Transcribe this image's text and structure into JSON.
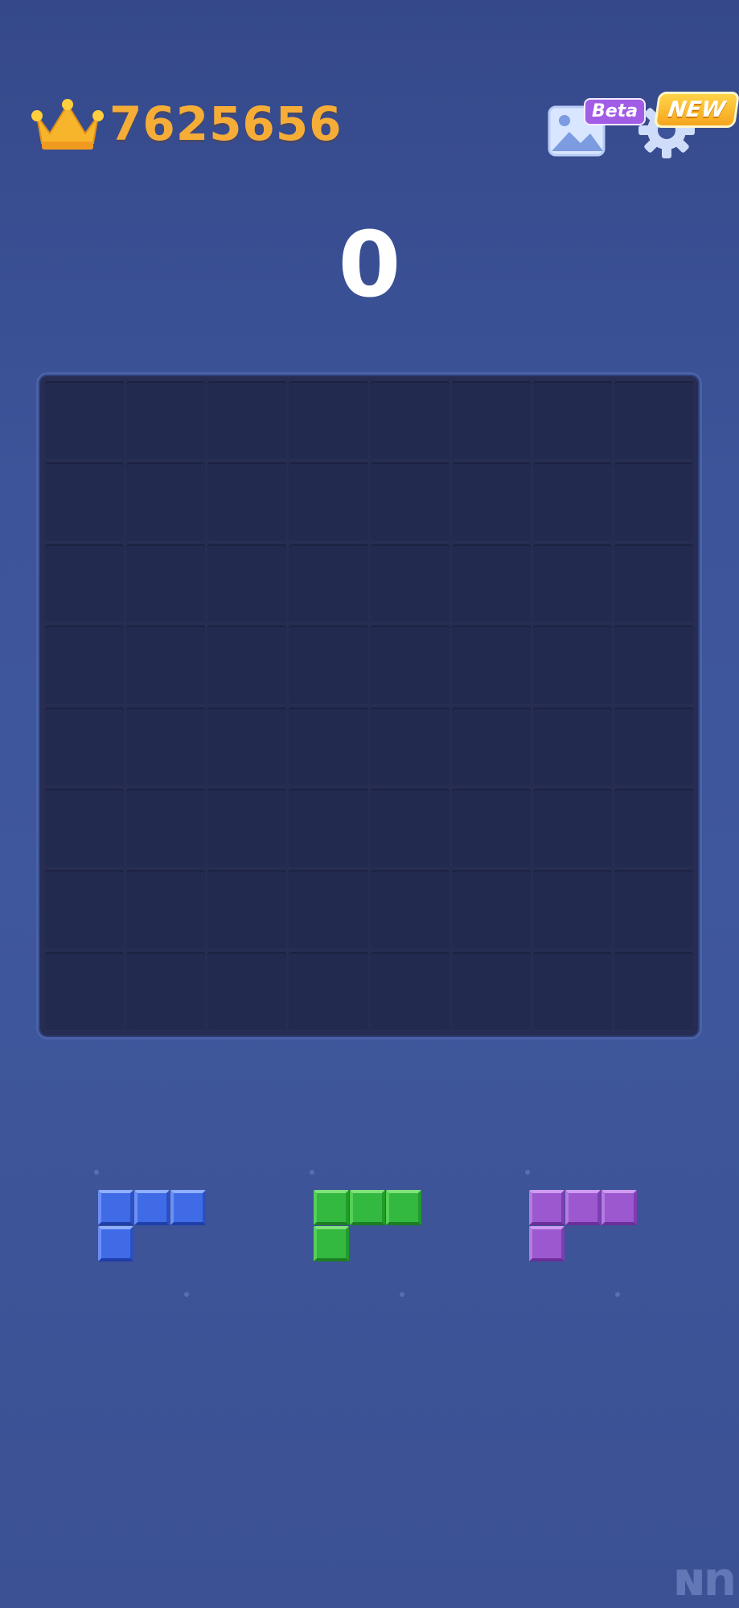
{
  "header": {
    "ghost_title": "",
    "best_score": "7625656",
    "gallery_badge": "Beta",
    "settings_badge": "NEW"
  },
  "score": {
    "current": "0"
  },
  "board": {
    "rows": 8,
    "cols": 8,
    "filled_cells": 0
  },
  "tray": {
    "pieces": [
      {
        "color_name": "blue",
        "color": "#3f6ce6",
        "shape": "L-three-top-one-below-left"
      },
      {
        "color_name": "green",
        "color": "#33b840",
        "shape": "L-three-top-one-below-left"
      },
      {
        "color_name": "purple",
        "color": "#9b58cf",
        "shape": "L-three-top-one-below-left"
      }
    ]
  },
  "watermark": {
    "text": "ɴn"
  },
  "colors": {
    "accent_gold": "#f6ad38",
    "board_bg": "#262c52",
    "page_bg": "#3d549a"
  },
  "icons": [
    "crown-icon",
    "gallery-icon",
    "gear-icon"
  ]
}
